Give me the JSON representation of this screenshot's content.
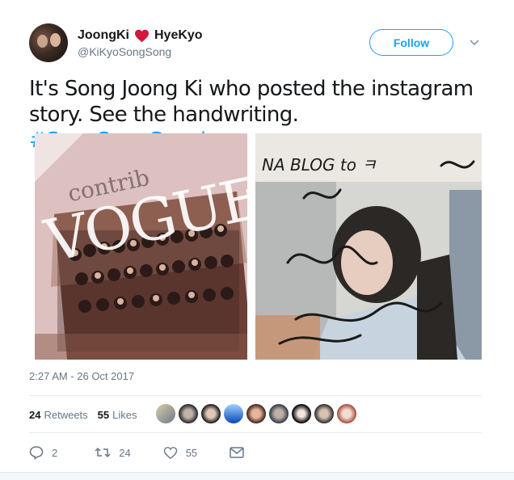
{
  "author": {
    "name_part1": "JoongKi",
    "name_part2": "HyeKyo",
    "handle": "@KiKyoSongSong",
    "heart_color": "#e0245e"
  },
  "follow_label": "Follow",
  "tweet": {
    "text": "It's Song Joong Ki who posted the instagram story. See the handwriting. ",
    "hashtag": "#SongSongCouple"
  },
  "photos": {
    "left_magazine_text": "contrib",
    "left_logo": "VOGUE",
    "right_handwriting": "NA BLOG  to ㅋ"
  },
  "timestamp": "2:27 AM - 26 Oct 2017",
  "stats": {
    "retweets_count": "24",
    "retweets_label": "Retweets",
    "likes_count": "55",
    "likes_label": "Likes"
  },
  "actions": {
    "reply_count": "2",
    "retweet_count": "24",
    "like_count": "55"
  },
  "colors": {
    "accent": "#1da1f2",
    "muted": "#657786",
    "text": "#14171a"
  }
}
